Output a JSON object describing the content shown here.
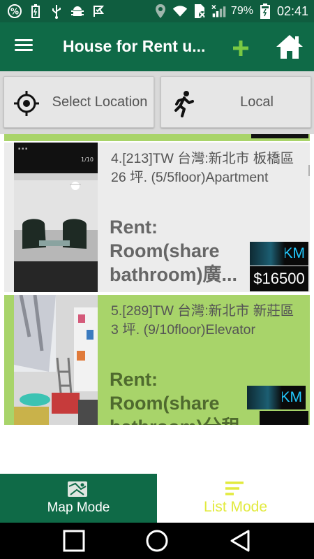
{
  "status_bar": {
    "battery_percent": "79%",
    "time": "02:41",
    "icons": [
      "percent-icon",
      "battery-small-icon",
      "usb-icon",
      "android-debug-icon",
      "check-flag-icon",
      "location-icon",
      "wifi-icon",
      "sim-off-icon",
      "signal-icon",
      "battery-icon"
    ]
  },
  "app_bar": {
    "title": "House for Rent u...",
    "icons": [
      "menu-icon",
      "plus-icon",
      "home-icon"
    ],
    "accent": "#7ac943"
  },
  "buttons": {
    "select_location": "Select Location",
    "local": "Local"
  },
  "listings": [
    {
      "title": "4.[213]TW 台灣:新北市 板橋區 26 坪. (5/5floor)Apartment",
      "type": "Rent:\nRoom(share\nbathroom)廣...",
      "distance": "KM",
      "price": "$16500"
    },
    {
      "title": "5.[289]TW 台灣:新北市 新莊區 3 坪. (9/10floor)Elevator",
      "type": "Rent:\nRoom(share\nbathroom)分租",
      "distance": "KM",
      "price": ""
    }
  ],
  "tabs": {
    "map_mode": "Map Mode",
    "list_mode": "List Mode",
    "active": "list_mode"
  },
  "colors": {
    "app_bar": "#0f6a47",
    "status_bar": "#0f5d3f",
    "highlight_row": "#a8d46a",
    "active_tab_text": "#e2ea3e",
    "distance_text": "#22c9ff"
  }
}
